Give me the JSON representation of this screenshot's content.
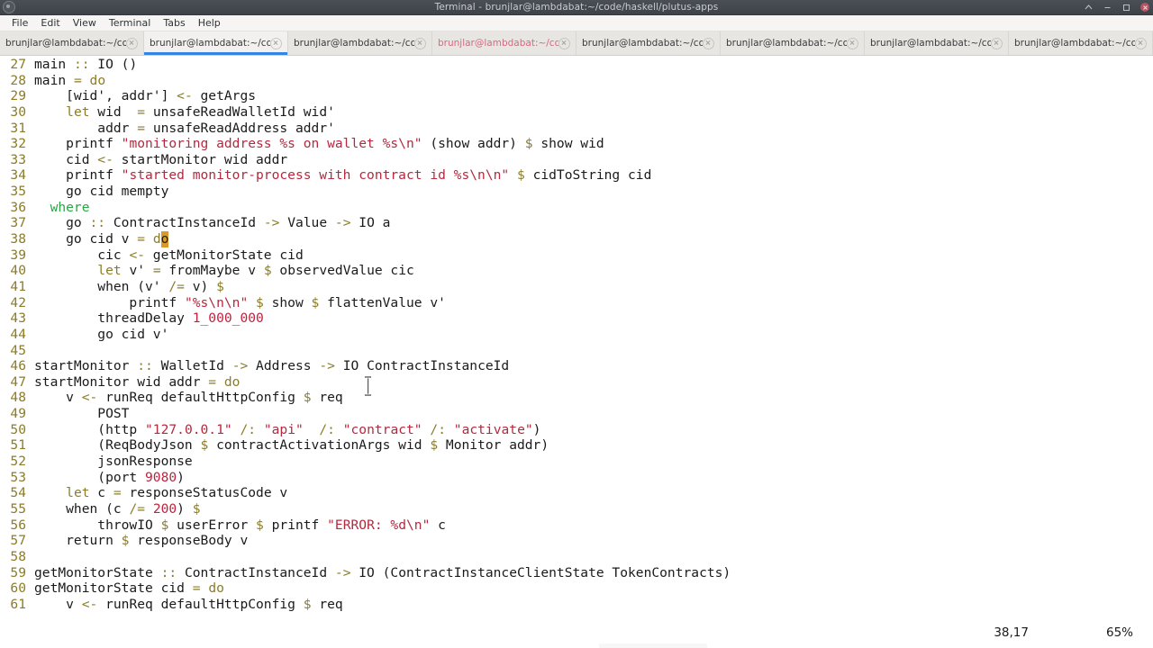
{
  "window": {
    "title": "Terminal - brunjlar@lambdabat:~/code/haskell/plutus-apps",
    "app_icon": "terminal-icon",
    "controls": {
      "minimize": "–",
      "maximize": "□",
      "close": "×"
    }
  },
  "menubar": {
    "items": [
      {
        "label": "File"
      },
      {
        "label": "Edit"
      },
      {
        "label": "View"
      },
      {
        "label": "Terminal"
      },
      {
        "label": "Tabs"
      },
      {
        "label": "Help"
      }
    ]
  },
  "tabbar": {
    "accent_color": "#3584e4",
    "bell_color": "#d46a7e",
    "tabs": [
      {
        "label": "brunjlar@lambdabat:~/co...",
        "active": false,
        "bell": false
      },
      {
        "label": "brunjlar@lambdabat:~/co...",
        "active": true,
        "bell": false
      },
      {
        "label": "brunjlar@lambdabat:~/co...",
        "active": false,
        "bell": false
      },
      {
        "label": "brunjlar@lambdabat:~/co...",
        "active": false,
        "bell": true
      },
      {
        "label": "brunjlar@lambdabat:~/co...",
        "active": false,
        "bell": false
      },
      {
        "label": "brunjlar@lambdabat:~/co...",
        "active": false,
        "bell": false
      },
      {
        "label": "brunjlar@lambdabat:~/co...",
        "active": false,
        "bell": false
      },
      {
        "label": "brunjlar@lambdabat:~/co...",
        "active": false,
        "bell": false
      }
    ]
  },
  "editor": {
    "language": "haskell",
    "colors": {
      "background": "#ffffff",
      "foreground": "#1a1a1a",
      "line_number": "#8a7c28",
      "operator": "#8a7c28",
      "keyword": "#8a7c28",
      "where_keyword": "#28a745",
      "string": "#b3293e",
      "number": "#c0223c",
      "cursor": "#d99a2b"
    },
    "first_line_number": 27,
    "lines": [
      {
        "n": "27",
        "text": "main :: IO ()"
      },
      {
        "n": "28",
        "text": "main = do"
      },
      {
        "n": "29",
        "text": "    [wid', addr'] <- getArgs"
      },
      {
        "n": "30",
        "text": "    let wid  = unsafeReadWalletId wid'"
      },
      {
        "n": "31",
        "text": "        addr = unsafeReadAddress addr'"
      },
      {
        "n": "32",
        "text": "    printf \"monitoring address %s on wallet %s\\n\" (show addr) $ show wid"
      },
      {
        "n": "33",
        "text": "    cid <- startMonitor wid addr"
      },
      {
        "n": "34",
        "text": "    printf \"started monitor-process with contract id %s\\n\\n\" $ cidToString cid"
      },
      {
        "n": "35",
        "text": "    go cid mempty"
      },
      {
        "n": "36",
        "text": "  where"
      },
      {
        "n": "37",
        "text": "    go :: ContractInstanceId -> Value -> IO a"
      },
      {
        "n": "38",
        "text": "    go cid v = do"
      },
      {
        "n": "39",
        "text": "        cic <- getMonitorState cid"
      },
      {
        "n": "40",
        "text": "        let v' = fromMaybe v $ observedValue cic"
      },
      {
        "n": "41",
        "text": "        when (v' /= v) $"
      },
      {
        "n": "42",
        "text": "            printf \"%s\\n\\n\" $ show $ flattenValue v'"
      },
      {
        "n": "43",
        "text": "        threadDelay 1_000_000"
      },
      {
        "n": "44",
        "text": "        go cid v'"
      },
      {
        "n": "45",
        "text": ""
      },
      {
        "n": "46",
        "text": "startMonitor :: WalletId -> Address -> IO ContractInstanceId"
      },
      {
        "n": "47",
        "text": "startMonitor wid addr = do"
      },
      {
        "n": "48",
        "text": "    v <- runReq defaultHttpConfig $ req"
      },
      {
        "n": "49",
        "text": "        POST"
      },
      {
        "n": "50",
        "text": "        (http \"127.0.0.1\" /: \"api\"  /: \"contract\" /: \"activate\")"
      },
      {
        "n": "51",
        "text": "        (ReqBodyJson $ contractActivationArgs wid $ Monitor addr)"
      },
      {
        "n": "52",
        "text": "        jsonResponse"
      },
      {
        "n": "53",
        "text": "        (port 9080)"
      },
      {
        "n": "54",
        "text": "    let c = responseStatusCode v"
      },
      {
        "n": "55",
        "text": "    when (c /= 200) $"
      },
      {
        "n": "56",
        "text": "        throwIO $ userError $ printf \"ERROR: %d\\n\" c"
      },
      {
        "n": "57",
        "text": "    return $ responseBody v"
      },
      {
        "n": "58",
        "text": ""
      },
      {
        "n": "59",
        "text": "getMonitorState :: ContractInstanceId -> IO (ContractInstanceClientState TokenContracts)"
      },
      {
        "n": "60",
        "text": "getMonitorState cid = do"
      },
      {
        "n": "61",
        "text": "    v <- runReq defaultHttpConfig $ req"
      }
    ],
    "cursor": {
      "line": 38,
      "column": 17,
      "char": "o"
    }
  },
  "statusbar": {
    "position": "38,17",
    "scroll_percent": "65%"
  }
}
